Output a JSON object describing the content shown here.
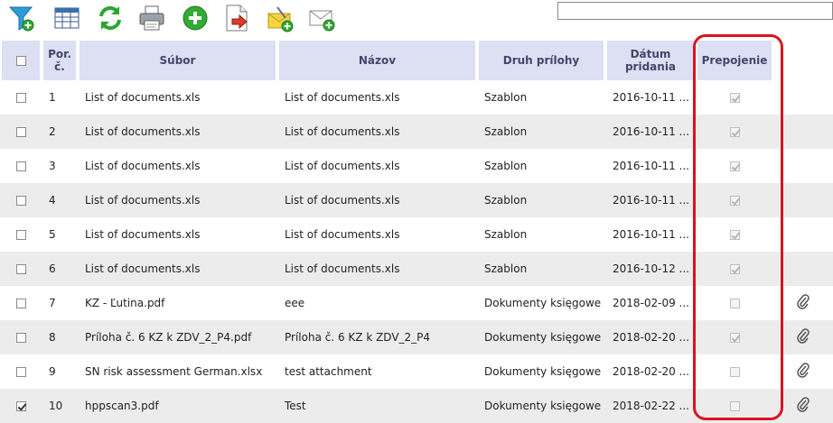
{
  "toolbar": {
    "icons": [
      "filter-add-icon",
      "table-view-icon",
      "refresh-icon",
      "print-icon",
      "add-icon",
      "export-icon",
      "attach-mail-icon",
      "new-mail-icon"
    ]
  },
  "search": {
    "value": ""
  },
  "table": {
    "headers": {
      "select": "",
      "number": "Por. č.",
      "file": "Súbor",
      "name": "Názov",
      "type": "Druh prílohy",
      "date": "Dátum pridania",
      "link": "Prepojenie"
    },
    "rows": [
      {
        "selected": false,
        "number": "1",
        "file": "List of documents.xls",
        "name": "List of documents.xls",
        "type": "Szablon",
        "date": "2016-10-11 ...",
        "linked": true,
        "attachment": false
      },
      {
        "selected": false,
        "number": "2",
        "file": "List of documents.xls",
        "name": "List of documents.xls",
        "type": "Szablon",
        "date": "2016-10-11 ...",
        "linked": true,
        "attachment": false
      },
      {
        "selected": false,
        "number": "3",
        "file": "List of documents.xls",
        "name": "List of documents.xls",
        "type": "Szablon",
        "date": "2016-10-11 ...",
        "linked": true,
        "attachment": false
      },
      {
        "selected": false,
        "number": "4",
        "file": "List of documents.xls",
        "name": "List of documents.xls",
        "type": "Szablon",
        "date": "2016-10-11 ...",
        "linked": true,
        "attachment": false
      },
      {
        "selected": false,
        "number": "5",
        "file": "List of documents.xls",
        "name": "List of documents.xls",
        "type": "Szablon",
        "date": "2016-10-11 ...",
        "linked": true,
        "attachment": false
      },
      {
        "selected": false,
        "number": "6",
        "file": "List of documents.xls",
        "name": "List of documents.xls",
        "type": "Szablon",
        "date": "2016-10-12 ...",
        "linked": true,
        "attachment": false
      },
      {
        "selected": false,
        "number": "7",
        "file": "KZ - Ľutina.pdf",
        "name": "eee",
        "type": "Dokumenty księgowe",
        "date": "2018-02-09 ...",
        "linked": false,
        "attachment": true
      },
      {
        "selected": false,
        "number": "8",
        "file": "Príloha č. 6 KZ k ZDV_2_P4.pdf",
        "name": "Príloha č. 6 KZ k ZDV_2_P4",
        "type": "Dokumenty księgowe",
        "date": "2018-02-20 ...",
        "linked": true,
        "attachment": true
      },
      {
        "selected": false,
        "number": "9",
        "file": "SN risk assessment German.xlsx",
        "name": "test attachment",
        "type": "Dokumenty księgowe",
        "date": "2018-02-20 ...",
        "linked": false,
        "attachment": true
      },
      {
        "selected": true,
        "number": "10",
        "file": "hppscan3.pdf",
        "name": "Test",
        "type": "Dokumenty księgowe",
        "date": "2018-02-22 ...",
        "linked": false,
        "attachment": true
      }
    ]
  },
  "colors": {
    "header_bg": "#dde0f2",
    "header_text": "#41466e",
    "row_alt": "#ececec",
    "highlight": "#d9141e"
  }
}
